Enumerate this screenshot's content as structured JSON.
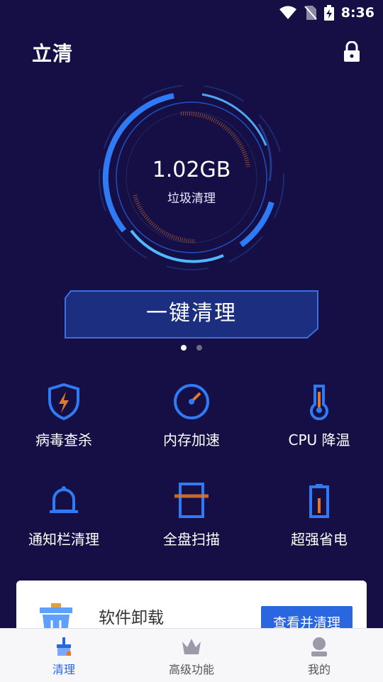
{
  "status_bar": {
    "time": "8:36"
  },
  "app": {
    "title": "立清"
  },
  "junk": {
    "size": "1.02GB",
    "label": "垃圾清理"
  },
  "clean_button": {
    "label": "一键清理"
  },
  "features": [
    {
      "label": "病毒查杀",
      "icon": "shield-bolt-icon"
    },
    {
      "label": "内存加速",
      "icon": "speedometer-icon"
    },
    {
      "label": "CPU 降温",
      "icon": "thermometer-icon"
    },
    {
      "label": "通知栏清理",
      "icon": "bell-icon"
    },
    {
      "label": "全盘扫描",
      "icon": "scan-icon"
    },
    {
      "label": "超强省电",
      "icon": "battery-icon"
    }
  ],
  "card": {
    "title": "软件卸载",
    "action": "查看并清理"
  },
  "bottom_nav": [
    {
      "label": "清理",
      "icon": "broom-icon",
      "active": true
    },
    {
      "label": "高级功能",
      "icon": "crown-icon",
      "active": false
    },
    {
      "label": "我的",
      "icon": "user-icon",
      "active": false
    }
  ],
  "colors": {
    "background": "#150f45",
    "accent": "#2a66e0",
    "orange": "#e07a2a"
  }
}
